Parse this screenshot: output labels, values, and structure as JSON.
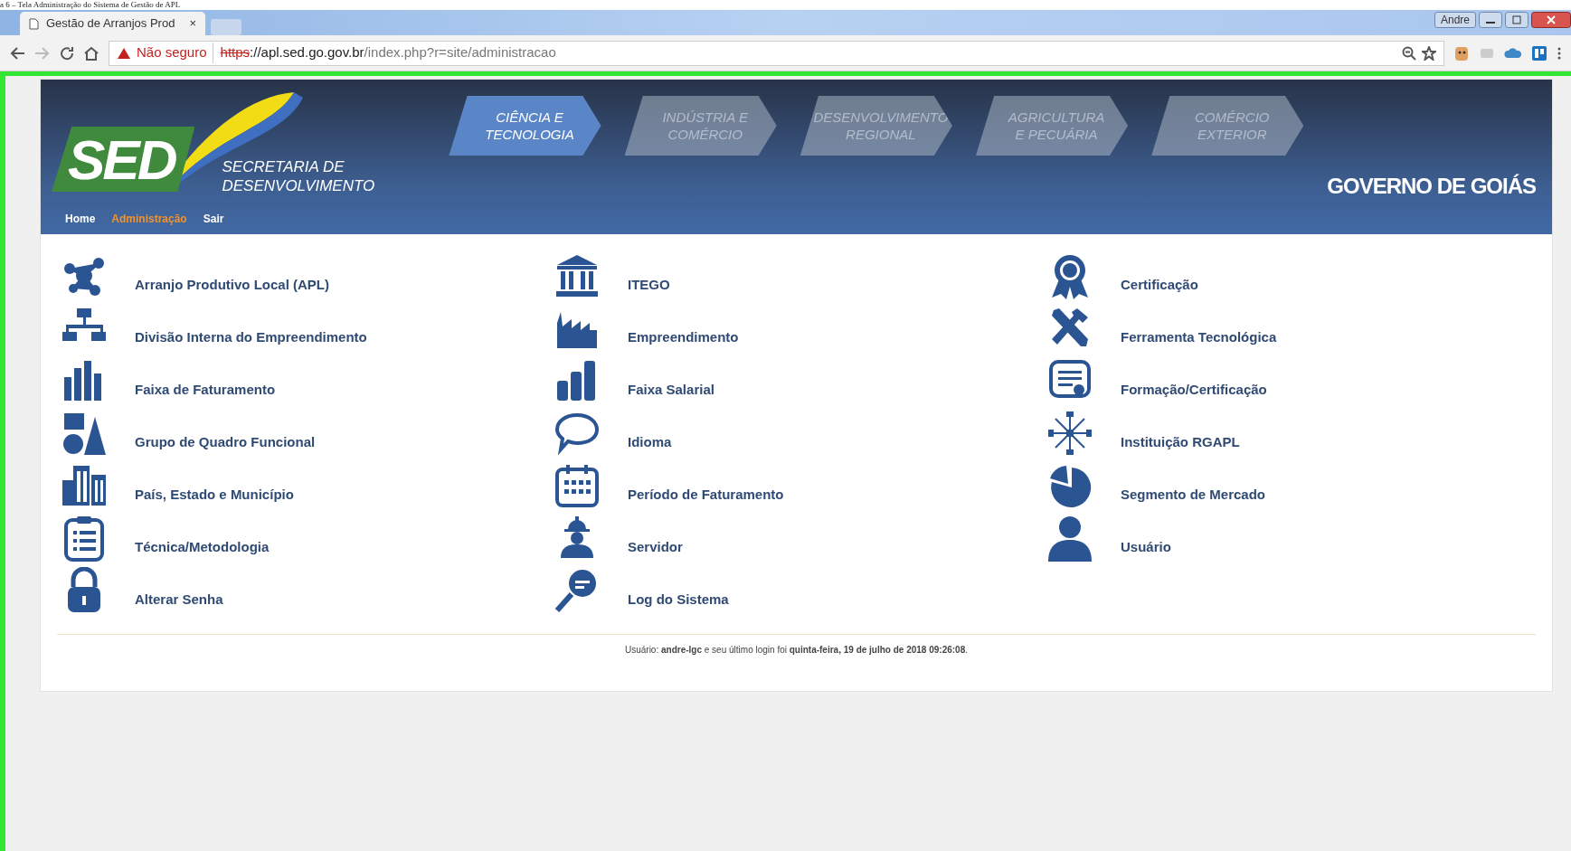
{
  "caption": "a 6 – Tela Administração do Sistema de Gestão de APL",
  "browser": {
    "tab_title": "Gestão de Arranjos Prod",
    "tab_close": "×",
    "profile": "Andre",
    "security": "Não seguro",
    "url_scheme": "https",
    "url_host": "://apl.sed.go.gov.br",
    "url_path": "/index.php?r=site/administracao"
  },
  "header": {
    "logo": "SED",
    "logo_line_1": "SECRETARIA DE",
    "logo_line_2": "DESENVOLVIMENTO",
    "government": "GOVERNO DE GOIÁS",
    "sectors": [
      {
        "line_1": "CIÊNCIA E",
        "line_2": "TECNOLOGIA",
        "selected": true
      },
      {
        "line_1": "INDÚSTRIA E",
        "line_2": "COMÉRCIO",
        "selected": false
      },
      {
        "line_1": "DESENVOLVIMENTO",
        "line_2": "REGIONAL",
        "selected": false
      },
      {
        "line_1": "AGRICULTURA",
        "line_2": "E PECUÁRIA",
        "selected": false
      },
      {
        "line_1": "COMÉRCIO",
        "line_2": "EXTERIOR",
        "selected": false
      }
    ]
  },
  "menu": [
    {
      "label": "Home",
      "selected": false
    },
    {
      "label": "Administração",
      "selected": true
    },
    {
      "label": "Sair",
      "selected": false
    }
  ],
  "items": [
    {
      "label": "Arranjo Produtivo Local (APL)"
    },
    {
      "label": "ITEGO"
    },
    {
      "label": "Certificação"
    },
    {
      "label": "Divisão Interna do Empreendimento"
    },
    {
      "label": "Empreendimento"
    },
    {
      "label": "Ferramenta Tecnológica"
    },
    {
      "label": "Faixa de Faturamento"
    },
    {
      "label": "Faixa Salarial"
    },
    {
      "label": "Formação/Certificação"
    },
    {
      "label": "Grupo de Quadro Funcional"
    },
    {
      "label": "Idioma"
    },
    {
      "label": "Instituição RGAPL"
    },
    {
      "label": "País, Estado e Município"
    },
    {
      "label": "Período de Faturamento"
    },
    {
      "label": "Segmento de Mercado"
    },
    {
      "label": "Técnica/Metodologia"
    },
    {
      "label": "Servidor"
    },
    {
      "label": "Usuário"
    },
    {
      "label": "Alterar Senha"
    },
    {
      "label": "Log do Sistema"
    }
  ],
  "footer": "Usuário: **andre-lgc** e seu último login foi **quinta-feira, 19 de julho de 2018 09:26:08**."
}
